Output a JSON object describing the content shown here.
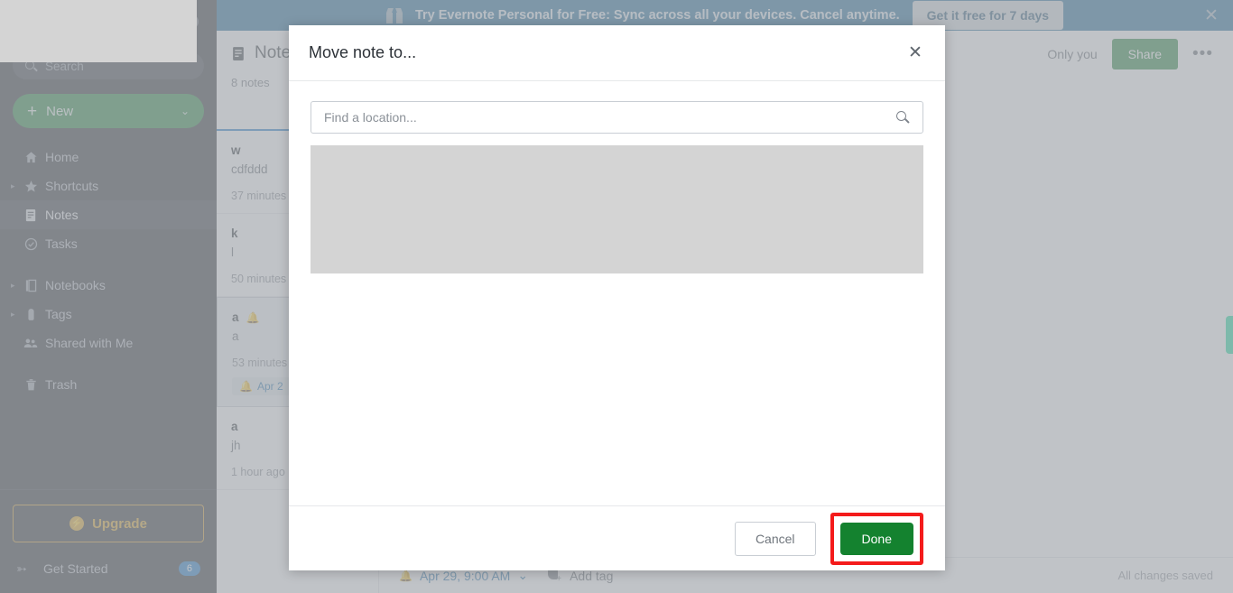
{
  "promo": {
    "icon": "gift-icon",
    "text": "Try Evernote Personal for Free: Sync across all your devices. Cancel anytime.",
    "cta": "Get it free for 7 days",
    "close": "✕"
  },
  "sidebar": {
    "search_placeholder": "Search",
    "new_label": "New",
    "new_plus": "+",
    "new_chevron": "⌄",
    "items": [
      {
        "label": "Home",
        "icon": "home-icon",
        "caret": "",
        "active": false
      },
      {
        "label": "Shortcuts",
        "icon": "star-icon",
        "caret": "▸",
        "active": false
      },
      {
        "label": "Notes",
        "icon": "note-icon",
        "caret": "",
        "active": true
      },
      {
        "label": "Tasks",
        "icon": "check-circle-icon",
        "caret": "",
        "active": false
      },
      {
        "label": "Notebooks",
        "icon": "notebook-icon",
        "caret": "▸",
        "active": false
      },
      {
        "label": "Tags",
        "icon": "tag-icon",
        "caret": "▸",
        "active": false
      },
      {
        "label": "Shared with Me",
        "icon": "people-icon",
        "caret": "",
        "active": false
      },
      {
        "label": "Trash",
        "icon": "trash-icon",
        "caret": "",
        "active": false
      }
    ],
    "upgrade_label": "Upgrade",
    "upgrade_bolt": "⚡",
    "get_started_label": "Get Started",
    "get_started_badge": "6",
    "rocket_icon": "➳"
  },
  "notelist": {
    "title": "Notes",
    "count": "8 notes",
    "notes": [
      {
        "title": "w",
        "snippet": "cdfddd",
        "date": "37 minutes",
        "reminder": "",
        "chip": "",
        "selected": false
      },
      {
        "title": "k",
        "snippet": "l",
        "date": "50 minutes",
        "reminder": "",
        "chip": "",
        "selected": false
      },
      {
        "title": "a",
        "snippet": "a",
        "date": "53 minutes",
        "reminder": "🔔",
        "chip": "Apr 2",
        "selected": true
      },
      {
        "title": "a",
        "snippet": "jh",
        "date": "1 hour ago",
        "reminder": "",
        "chip": "",
        "selected": false
      }
    ]
  },
  "editor": {
    "visibility": "Only you",
    "share_label": "Share",
    "more": "•••",
    "reminder": "Apr 29, 9:00 AM",
    "reminder_chevron": "⌄",
    "add_tag": "Add tag",
    "saved_status": "All changes saved"
  },
  "modal": {
    "title": "Move note to...",
    "close": "✕",
    "search_placeholder": "Find a location...",
    "cancel_label": "Cancel",
    "done_label": "Done"
  },
  "colors": {
    "brand_green": "#1b7d35",
    "banner_blue": "#15618f",
    "highlight_red": "#f41b1b",
    "accent_blue": "#1273c4",
    "upgrade_gold": "#d9a01f"
  }
}
